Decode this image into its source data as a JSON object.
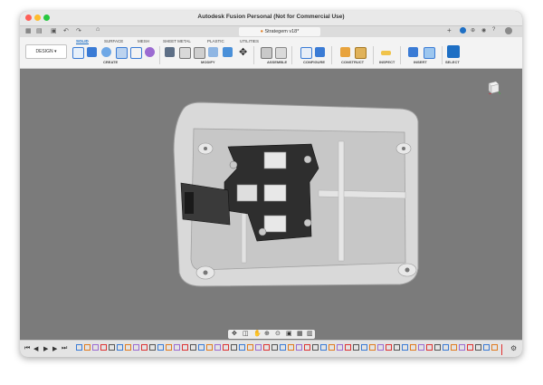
{
  "window": {
    "title": "Autodesk Fusion Personal (Not for Commercial Use)"
  },
  "document_tab": {
    "name": "Strategem v18*"
  },
  "workspace": {
    "label": "DESIGN"
  },
  "ribbon": {
    "tabs": [
      "SOLID",
      "SURFACE",
      "MESH",
      "SHEET METAL",
      "PLASTIC",
      "UTILITIES"
    ],
    "active_tab": "SOLID",
    "groups": [
      "CREATE",
      "MODIFY",
      "ASSEMBLE",
      "CONFIGURE",
      "CONSTRUCT",
      "INSPECT",
      "INSERT",
      "SELECT"
    ]
  },
  "viewcube": {
    "label": "RIGHT"
  },
  "colors": {
    "accent": "#1e6fc4",
    "viewport": "#7b7b7b",
    "pcb": "#2e2e2e",
    "enclosure": "#dcdcdc"
  },
  "icons": [
    "apple-logo",
    "grid-icon",
    "file-icon",
    "save-icon",
    "undo-icon",
    "redo-icon",
    "home-icon",
    "gear-icon",
    "help-icon",
    "user-icon"
  ]
}
